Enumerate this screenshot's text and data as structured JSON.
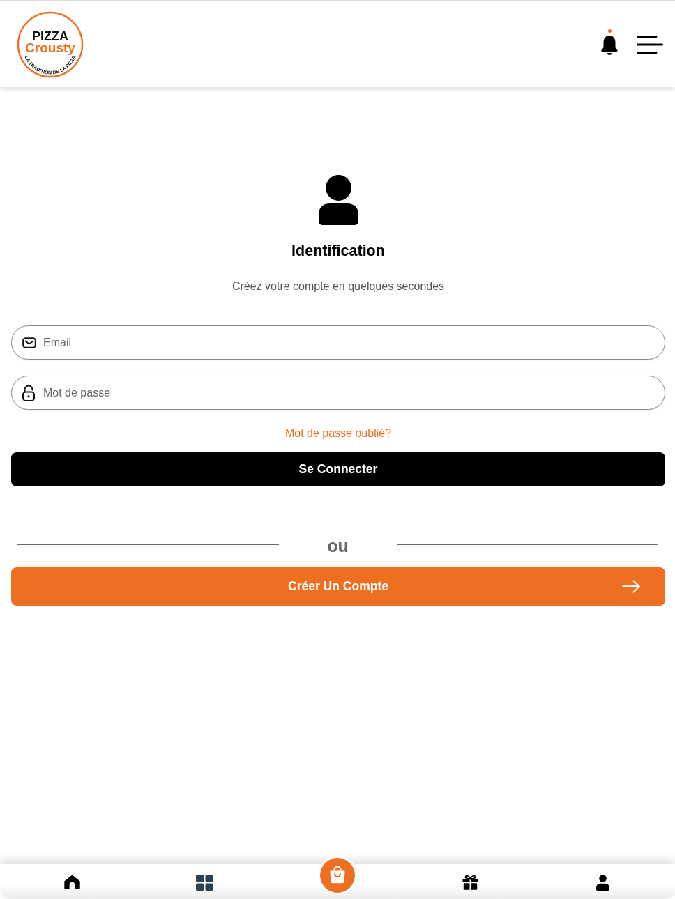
{
  "header": {
    "logo": {
      "title": "PIZZA",
      "subtitle": "Crousty",
      "tagline": "LA TRADITION DE LA PIZZA"
    },
    "notifications": {
      "unread": true
    }
  },
  "login": {
    "title": "Identification",
    "subtitle": "Créez votre compte en quelques secondes",
    "fields": [
      {
        "kind": "email",
        "placeholder": "Email"
      },
      {
        "kind": "password",
        "placeholder": "Mot de passe"
      }
    ],
    "forgot_link": "Mot de passe oublié?",
    "submit_button": "Se Connecter",
    "separator": "ou",
    "signup_button": "Créer Un Compte"
  },
  "bottom_nav": [
    {
      "kind": "home"
    },
    {
      "kind": "grid"
    },
    {
      "kind": "bag"
    },
    {
      "kind": "gift"
    },
    {
      "kind": "person"
    }
  ]
}
